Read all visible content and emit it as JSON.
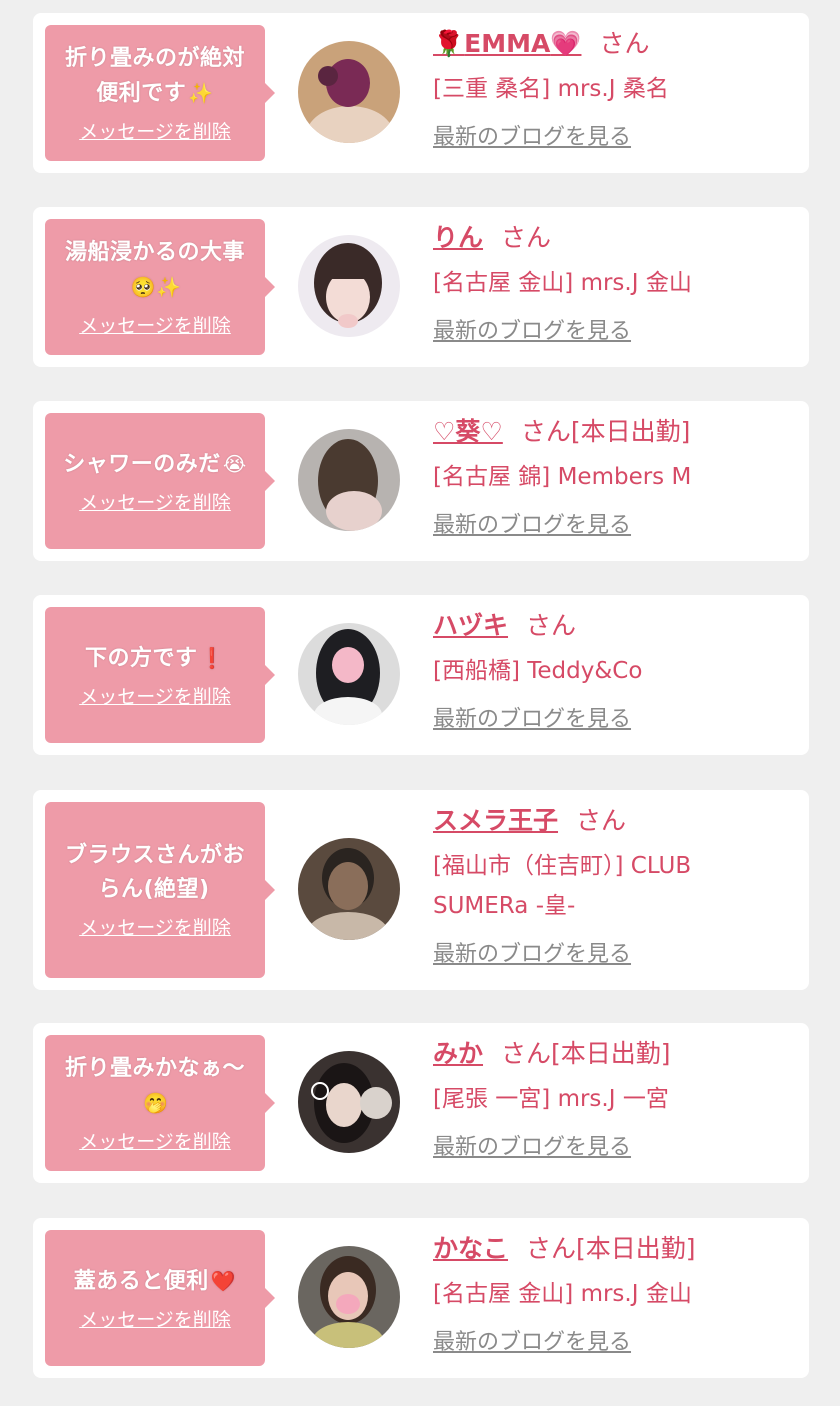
{
  "entries": [
    {
      "message": "折り畳みのが絶対便利です",
      "message_emoji": "✨",
      "delete_label": "メッセージを削除",
      "name_prefix": "🌹",
      "name": "EMMA",
      "name_suffix": "💗",
      "honorific": "さん",
      "status": "",
      "shop": "[三重 桑名] mrs.J 桑名",
      "blog_label": "最新のブログを見る",
      "avatar_colors": [
        "#c9a27a",
        "#7a2a55",
        "#e8d2c0"
      ]
    },
    {
      "message": "湯船浸かるの大事",
      "message_emoji": "🥺✨",
      "delete_label": "メッセージを削除",
      "name_prefix": "",
      "name": "りん",
      "name_suffix": "",
      "honorific": "さん",
      "status": "",
      "shop": "[名古屋 金山] mrs.J 金山",
      "blog_label": "最新のブログを見る",
      "avatar_colors": [
        "#eeeaf0",
        "#3a2a28",
        "#f1c9c9"
      ]
    },
    {
      "message": "シャワーのみだ",
      "message_emoji": "😭",
      "delete_label": "メッセージを削除",
      "name_prefix": "",
      "name": "♡葵♡",
      "name_suffix": "",
      "honorific": "さん",
      "status": "[本日出勤]",
      "shop": "[名古屋 錦] Members M",
      "blog_label": "最新のブログを見る",
      "avatar_colors": [
        "#b7b3b0",
        "#4a3a30",
        "#e7d1cd"
      ]
    },
    {
      "message": "下の方です",
      "message_emoji": "❗",
      "delete_label": "メッセージを削除",
      "name_prefix": "",
      "name": "ハヅキ",
      "name_suffix": "",
      "honorific": "さん",
      "status": "",
      "shop": "[西船橋] Teddy&Co",
      "blog_label": "最新のブログを見る",
      "avatar_colors": [
        "#dcdcdc",
        "#1e1e22",
        "#f4b8c8"
      ]
    },
    {
      "message": "ブラウスさんがおらん(絶望)",
      "message_emoji": "",
      "delete_label": "メッセージを削除",
      "name_prefix": "",
      "name": "スメラ王子",
      "name_suffix": "",
      "honorific": "さん",
      "status": "",
      "shop": "[福山市（住吉町）] CLUB SUMERa -皇-",
      "blog_label": "最新のブログを見る",
      "avatar_colors": [
        "#5a4a3e",
        "#2a2420",
        "#c8b8a8"
      ]
    },
    {
      "message": "折り畳みかなぁ〜",
      "message_emoji": "🤭",
      "delete_label": "メッセージを削除",
      "name_prefix": "",
      "name": "みか",
      "name_suffix": "",
      "honorific": "さん",
      "status": "[本日出勤]",
      "shop": "[尾張 一宮] mrs.J 一宮",
      "blog_label": "最新のブログを見る",
      "avatar_colors": [
        "#3a3230",
        "#1a1515",
        "#e9d6cc"
      ]
    },
    {
      "message": "蓋あると便利",
      "message_emoji": "❤️",
      "delete_label": "メッセージを削除",
      "name_prefix": "",
      "name": "かなこ",
      "name_suffix": "",
      "honorific": "さん",
      "status": "[本日出勤]",
      "shop": "[名古屋 金山] mrs.J 金山",
      "blog_label": "最新のブログを見る",
      "avatar_colors": [
        "#6a6660",
        "#3a2a22",
        "#e8c7b8"
      ]
    }
  ]
}
